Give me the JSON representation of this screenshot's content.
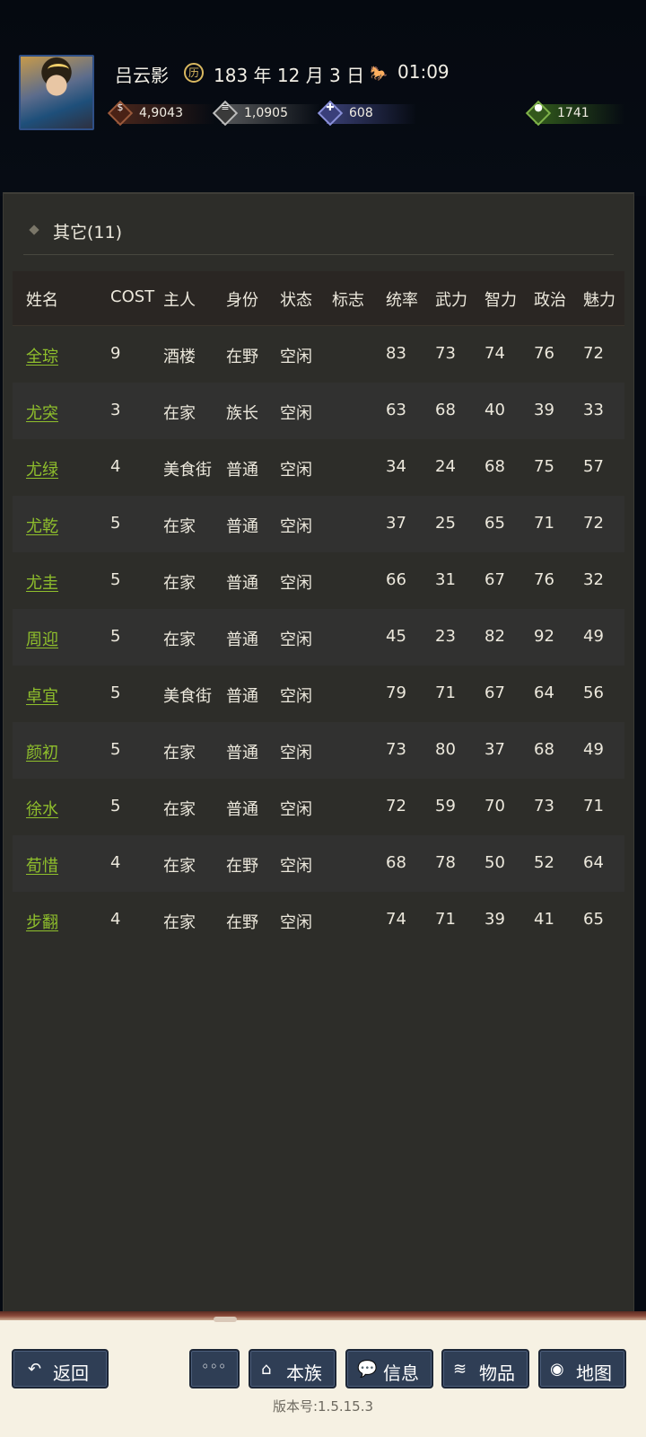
{
  "header": {
    "player_name": "吕云影",
    "date": "183 年 12 月 3 日",
    "time": "01:09",
    "resources": {
      "copper": "4,9043",
      "silver": "1,0905",
      "people": "608",
      "food": "1741"
    }
  },
  "section": {
    "title": "其它(11)"
  },
  "table": {
    "headers": [
      "姓名",
      "COST",
      "主人",
      "身份",
      "状态",
      "标志",
      "统率",
      "武力",
      "智力",
      "政治",
      "魅力"
    ],
    "rows": [
      {
        "name": "全琮",
        "cost": "9",
        "owner": "酒楼",
        "status": "在野",
        "state": "空闲",
        "mark": "",
        "lead": "83",
        "war": "73",
        "int": "74",
        "pol": "76",
        "cha": "72"
      },
      {
        "name": "尤突",
        "cost": "3",
        "owner": "在家",
        "status": "族长",
        "state": "空闲",
        "mark": "",
        "lead": "63",
        "war": "68",
        "int": "40",
        "pol": "39",
        "cha": "33"
      },
      {
        "name": "尤绿",
        "cost": "4",
        "owner": "美食街",
        "status": "普通",
        "state": "空闲",
        "mark": "",
        "lead": "34",
        "war": "24",
        "int": "68",
        "pol": "75",
        "cha": "57"
      },
      {
        "name": "尤乾",
        "cost": "5",
        "owner": "在家",
        "status": "普通",
        "state": "空闲",
        "mark": "",
        "lead": "37",
        "war": "25",
        "int": "65",
        "pol": "71",
        "cha": "72"
      },
      {
        "name": "尤圭",
        "cost": "5",
        "owner": "在家",
        "status": "普通",
        "state": "空闲",
        "mark": "",
        "lead": "66",
        "war": "31",
        "int": "67",
        "pol": "76",
        "cha": "32"
      },
      {
        "name": "周迎",
        "cost": "5",
        "owner": "在家",
        "status": "普通",
        "state": "空闲",
        "mark": "",
        "lead": "45",
        "war": "23",
        "int": "82",
        "pol": "92",
        "cha": "49"
      },
      {
        "name": "卓宜",
        "cost": "5",
        "owner": "美食街",
        "status": "普通",
        "state": "空闲",
        "mark": "",
        "lead": "79",
        "war": "71",
        "int": "67",
        "pol": "64",
        "cha": "56"
      },
      {
        "name": "颜初",
        "cost": "5",
        "owner": "在家",
        "status": "普通",
        "state": "空闲",
        "mark": "",
        "lead": "73",
        "war": "80",
        "int": "37",
        "pol": "68",
        "cha": "49"
      },
      {
        "name": "徐水",
        "cost": "5",
        "owner": "在家",
        "status": "普通",
        "state": "空闲",
        "mark": "",
        "lead": "72",
        "war": "59",
        "int": "70",
        "pol": "73",
        "cha": "71"
      },
      {
        "name": "荀惜",
        "cost": "4",
        "owner": "在家",
        "status": "在野",
        "state": "空闲",
        "mark": "",
        "lead": "68",
        "war": "78",
        "int": "50",
        "pol": "52",
        "cha": "64"
      },
      {
        "name": "步翻",
        "cost": "4",
        "owner": "在家",
        "status": "在野",
        "state": "空闲",
        "mark": "",
        "lead": "74",
        "war": "71",
        "int": "39",
        "pol": "41",
        "cha": "65"
      }
    ]
  },
  "bottom_bar": {
    "back": "返回",
    "more": "◦◦◦",
    "clan": "本族",
    "info": "信息",
    "items": "物品",
    "map": "地图",
    "version": "版本号:1.5.15.3"
  },
  "icons": {
    "date": "calendar-seal-icon",
    "time": "horse-icon",
    "copper": "coin-icon",
    "silver": "silver-icon",
    "people": "people-icon",
    "food": "food-sack-icon"
  },
  "colors": {
    "name_link": "#8fbf2c",
    "panel_bg": "#2d2d29",
    "button_bg": "#2f3e55"
  }
}
